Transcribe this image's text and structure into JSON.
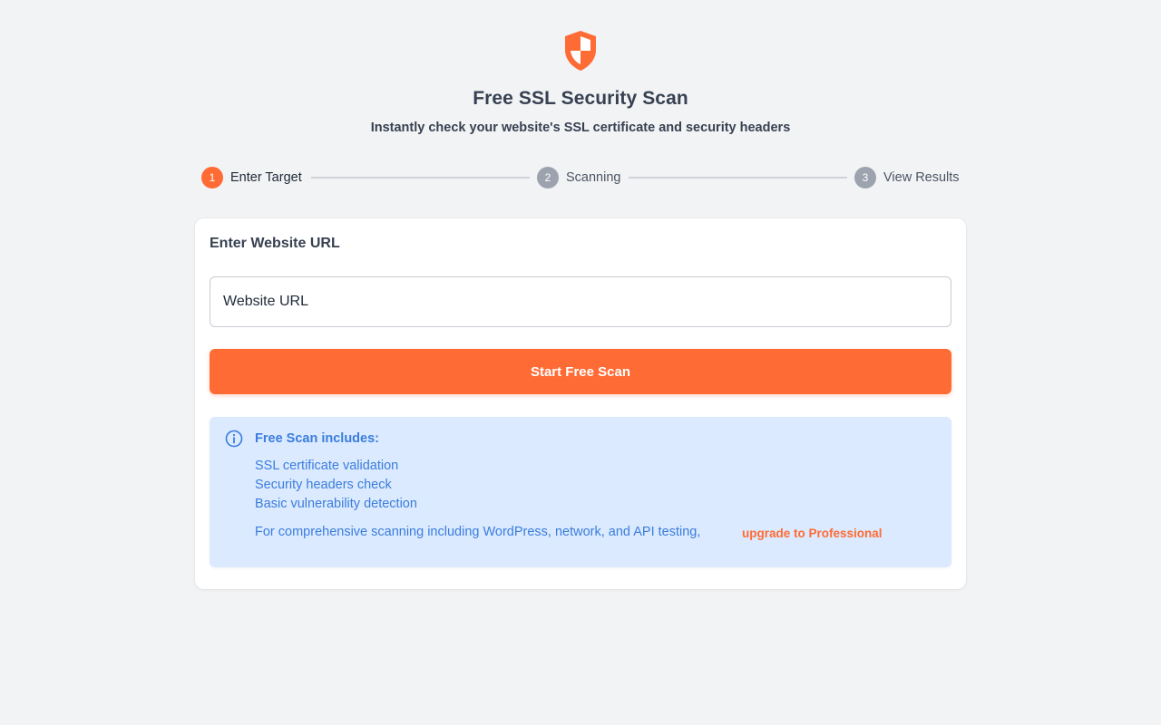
{
  "header": {
    "logo_icon": "shield-icon",
    "title": "Free SSL Security Scan",
    "subtitle": "Instantly check your website's SSL certificate and security headers"
  },
  "stepper": {
    "steps": [
      {
        "number": "1",
        "label": "Enter Target",
        "active": true
      },
      {
        "number": "2",
        "label": "Scanning",
        "active": false
      },
      {
        "number": "3",
        "label": "View Results",
        "active": false
      }
    ]
  },
  "form": {
    "title": "Enter Website URL",
    "url_placeholder": "Website URL",
    "url_value": "",
    "submit_label": "Start Free Scan"
  },
  "info": {
    "icon": "info-icon",
    "heading": "Free Scan includes:",
    "items": [
      "SSL certificate validation",
      "Security headers check",
      "Basic vulnerability detection"
    ],
    "footer_text": "For comprehensive scanning including WordPress, network, and API testing,",
    "upgrade_link": "upgrade to Professional"
  },
  "colors": {
    "accent": "#ff6b35",
    "info_bg": "#dbeafe",
    "info_text": "#3b7ddd",
    "page_bg": "#f2f3f5"
  }
}
